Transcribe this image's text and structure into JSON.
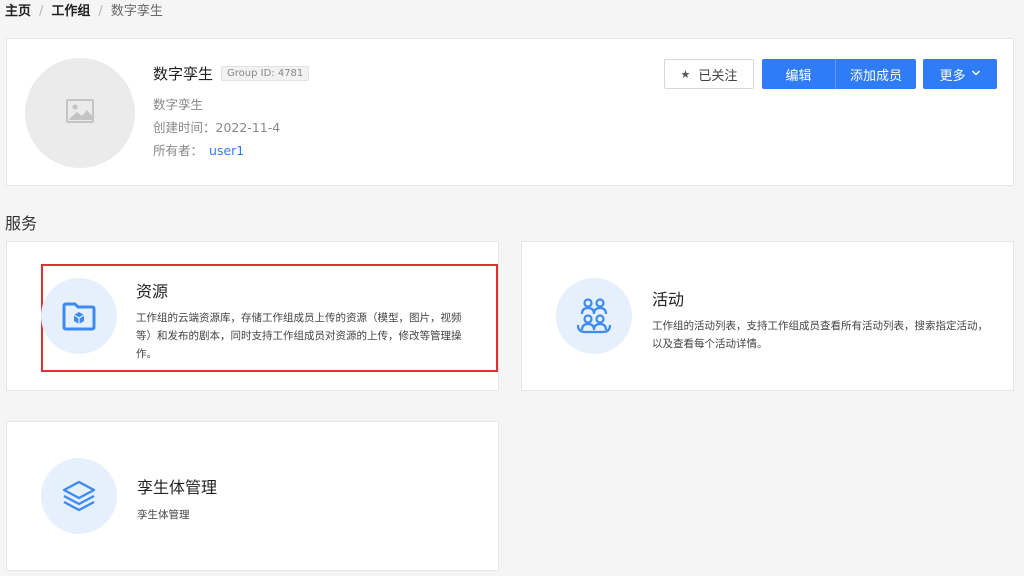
{
  "breadcrumb": {
    "home": "主页",
    "separator": "/",
    "workgroup": "工作组",
    "current": "数字孪生"
  },
  "group": {
    "name": "数字孪生",
    "id_badge": "Group ID: 4781",
    "description": "数字孪生",
    "created": "创建时间：2022-11-4",
    "owner_label": "所有者：",
    "owner_name": "user1",
    "avatar_icon": "image-placeholder-icon"
  },
  "actions": {
    "follow_icon": "star-icon",
    "follow_label": "已关注",
    "edit_label": "编辑",
    "add_member_label": "添加成员",
    "more_label": "更多",
    "more_icon": "chevron-down-icon"
  },
  "section_title": "服务",
  "services": [
    {
      "title": "资源",
      "icon": "folder-cube-icon",
      "description": "工作组的云端资源库，存储工作组成员上传的资源（模型，图片，视频等）和发布的剧本，同时支持工作组成员对资源的上传，修改等管理操作。",
      "highlighted": true
    },
    {
      "title": "活动",
      "icon": "people-group-icon",
      "description": "工作组的活动列表，支持工作组成员查看所有活动列表，搜索指定活动，以及查看每个活动详情。"
    },
    {
      "title": "孪生体管理",
      "icon": "layers-icon",
      "description": "孪生体管理"
    }
  ],
  "colors": {
    "primary": "#2f7cf6",
    "icon_bg": "#e6f0fc",
    "highlight": "#e03131",
    "page_bg": "#f5f5f5"
  }
}
